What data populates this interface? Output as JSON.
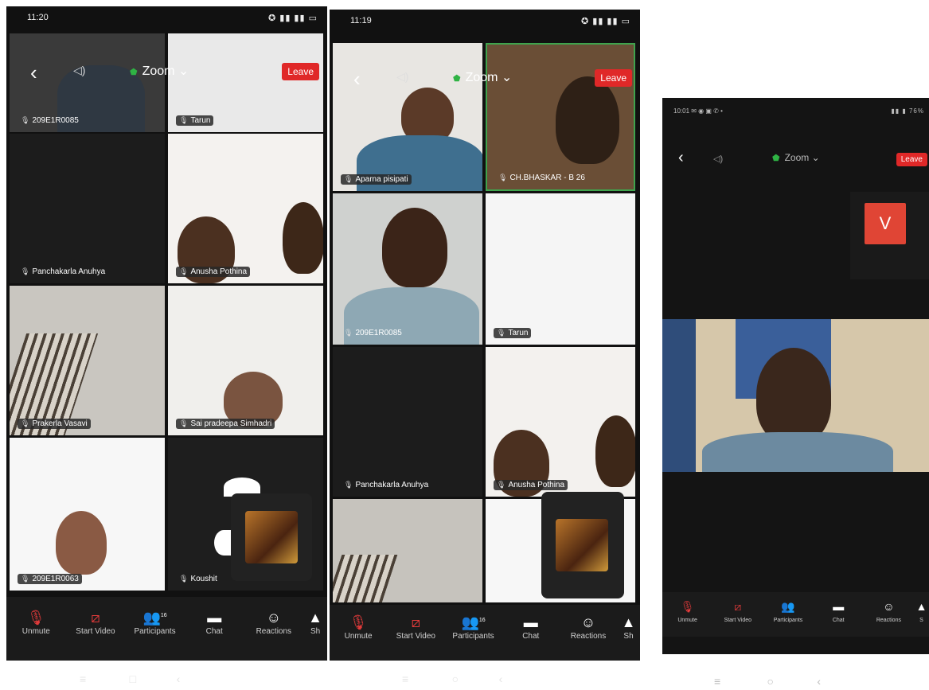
{
  "phones": [
    {
      "time": "11:20",
      "meeting_title": "Zoom",
      "leave_label": "Leave",
      "participants": [
        "209E1R0085",
        "Tarun",
        "Panchakarla Anuhya",
        "Anusha Pothina",
        "Prakerla Vasavi",
        "Sai pradeepa Simhadri",
        "209E1R0063",
        "Koushit"
      ],
      "toolbar": [
        "Unmute",
        "Start Video",
        "Participants",
        "Chat",
        "Reactions",
        "Sh"
      ],
      "participant_count": "16"
    },
    {
      "time": "11:19",
      "meeting_title": "Zoom",
      "leave_label": "Leave",
      "participants": [
        "Aparna pisipati",
        "CH.BHASKAR - B 26",
        "209E1R0085",
        "Tarun",
        "Panchakarla Anuhya",
        "Anusha Pothina"
      ],
      "toolbar": [
        "Unmute",
        "Start Video",
        "Participants",
        "Chat",
        "Reactions",
        "Sh"
      ],
      "participant_count": "16"
    },
    {
      "time": "10:01",
      "battery": "76%",
      "meeting_title": "Zoom",
      "leave_label": "Leave",
      "avatar_letter": "V",
      "toolbar": [
        "Unmute",
        "Start Video",
        "Participants",
        "Chat",
        "Reactions",
        "S"
      ]
    }
  ],
  "colors": {
    "leave": "#e02828",
    "shield": "#2fb344",
    "avatar": "#e04535"
  },
  "icons": [
    "back-chevron-icon",
    "speaker-icon",
    "shield-icon",
    "mic-muted-icon",
    "video-off-icon",
    "participants-icon",
    "chat-icon",
    "reactions-icon"
  ]
}
